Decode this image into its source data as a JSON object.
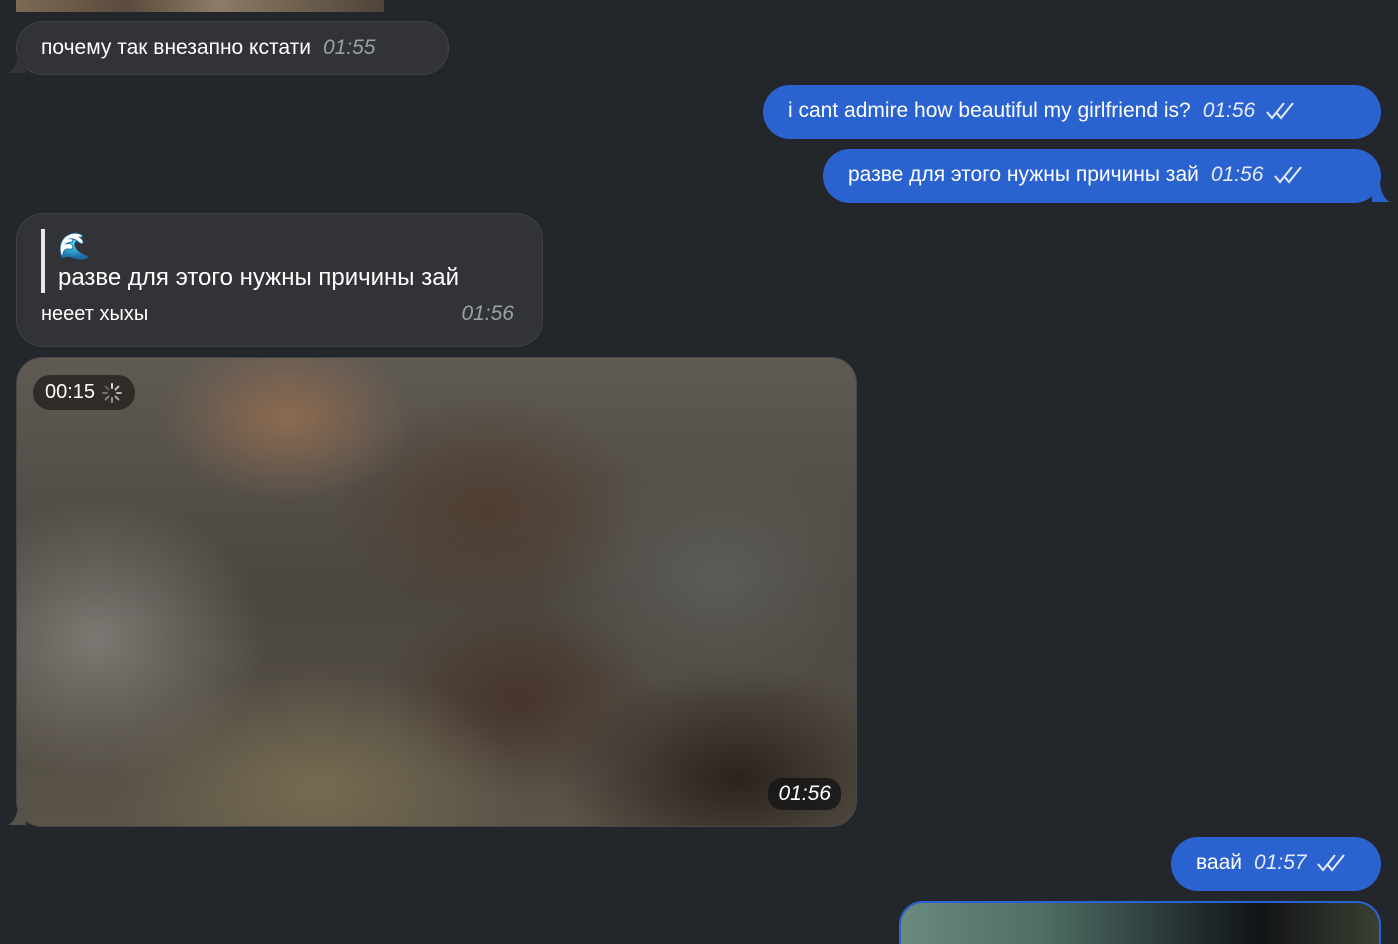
{
  "messages": [
    {
      "side": "in",
      "text": "почему так внезапно кстати",
      "time": "01:55"
    },
    {
      "side": "out",
      "text": "i cant admire how beautiful my girlfriend is?",
      "time": "01:56"
    },
    {
      "side": "out",
      "text": "разве для этого нужны причины зай",
      "time": "01:56"
    },
    {
      "side": "in",
      "reply": {
        "emoji": "🌊",
        "quoted_text": "разве для этого нужны причины зай"
      },
      "text": "нееет хыхы",
      "time": "01:56"
    },
    {
      "side": "in",
      "type": "video",
      "duration": "00:15",
      "time": "01:56"
    },
    {
      "side": "out",
      "text": "ваай",
      "time": "01:57"
    }
  ],
  "colors": {
    "background": "#23262b",
    "incoming_bubble": "#313336",
    "outgoing_bubble": "#2a62cf"
  },
  "icons": {
    "read_status": "double-check-icon",
    "loading": "spinner-icon"
  }
}
